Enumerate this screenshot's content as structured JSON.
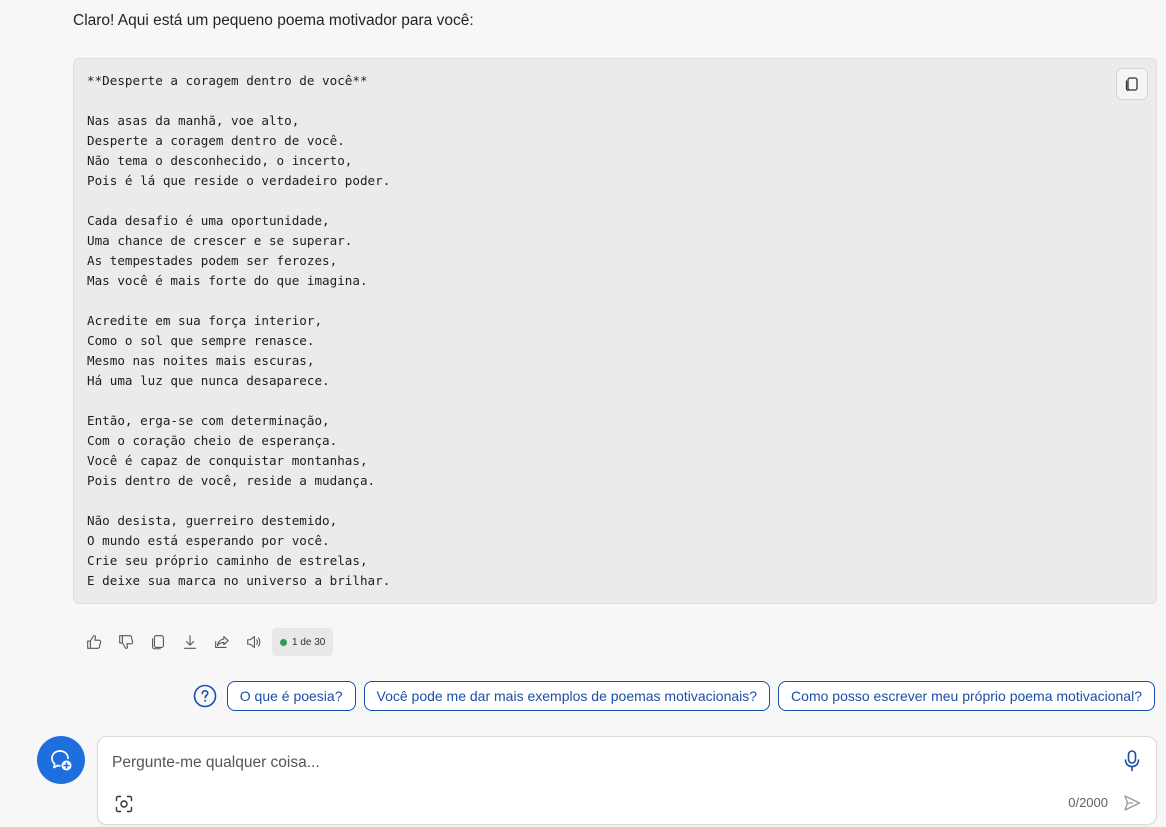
{
  "message": {
    "intro": "Claro! Aqui está um pequeno poema motivador para você:",
    "poem": "**Desperte a coragem dentro de você**\n\nNas asas da manhã, voe alto,\nDesperte a coragem dentro de você.\nNão tema o desconhecido, o incerto,\nPois é lá que reside o verdadeiro poder.\n\nCada desafio é uma oportunidade,\nUma chance de crescer e se superar.\nAs tempestades podem ser ferozes,\nMas você é mais forte do que imagina.\n\nAcredite em sua força interior,\nComo o sol que sempre renasce.\nMesmo nas noites mais escuras,\nHá uma luz que nunca desaparece.\n\nEntão, erga-se com determinação,\nCom o coração cheio de esperança.\nVocê é capaz de conquistar montanhas,\nPois dentro de você, reside a mudança.\n\nNão desista, guerreiro destemido,\nO mundo está esperando por você.\nCrie seu próprio caminho de estrelas,\nE deixe sua marca no universo a brilhar."
  },
  "actions": {
    "icons": [
      "thumbs-up-icon",
      "thumbs-down-icon",
      "copy-icon",
      "download-icon",
      "share-icon",
      "speaker-icon"
    ],
    "counter": "1 de 30",
    "counter_dot_color": "#2e9b4f"
  },
  "suggestions": [
    "O que é poesia?",
    "Você pode me dar mais exemplos de poemas motivacionais?",
    "Como posso escrever meu próprio poema motivacional?"
  ],
  "composer": {
    "placeholder": "Pergunte-me qualquer coisa...",
    "char_count": "0/2000"
  },
  "colors": {
    "accent": "#1a4fa8",
    "new_topic": "#1f6ede"
  }
}
